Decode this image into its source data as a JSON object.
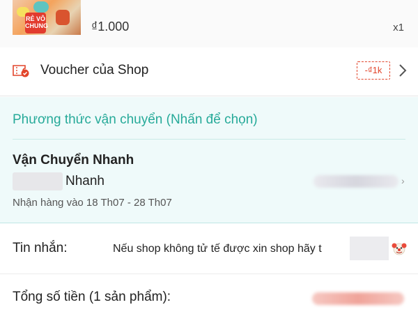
{
  "product": {
    "price": "₫1.000",
    "quantity": "x1",
    "thumbnail_badge": "RẺ VÔ CHUNG"
  },
  "voucher": {
    "label": "Voucher của Shop",
    "tag": "-₫1k",
    "icon": "voucher-ticket-icon",
    "accent_color": "#e2452b"
  },
  "shipping": {
    "header": "Phương thức vận chuyển (Nhấn để chọn)",
    "method_name": "Vận Chuyển Nhanh",
    "carrier": "Nhanh",
    "delivery_estimate": "Nhận hàng vào 18 Th07 - 28 Th07",
    "accent_color": "#26aa99",
    "background": "#effafa"
  },
  "message": {
    "label": "Tin nhắn:",
    "text": "Nếu shop không tử tế được xin shop hãy t",
    "emoji": "clown-face-icon"
  },
  "total": {
    "label": "Tổng số tiền (1 sản phẩm):"
  }
}
